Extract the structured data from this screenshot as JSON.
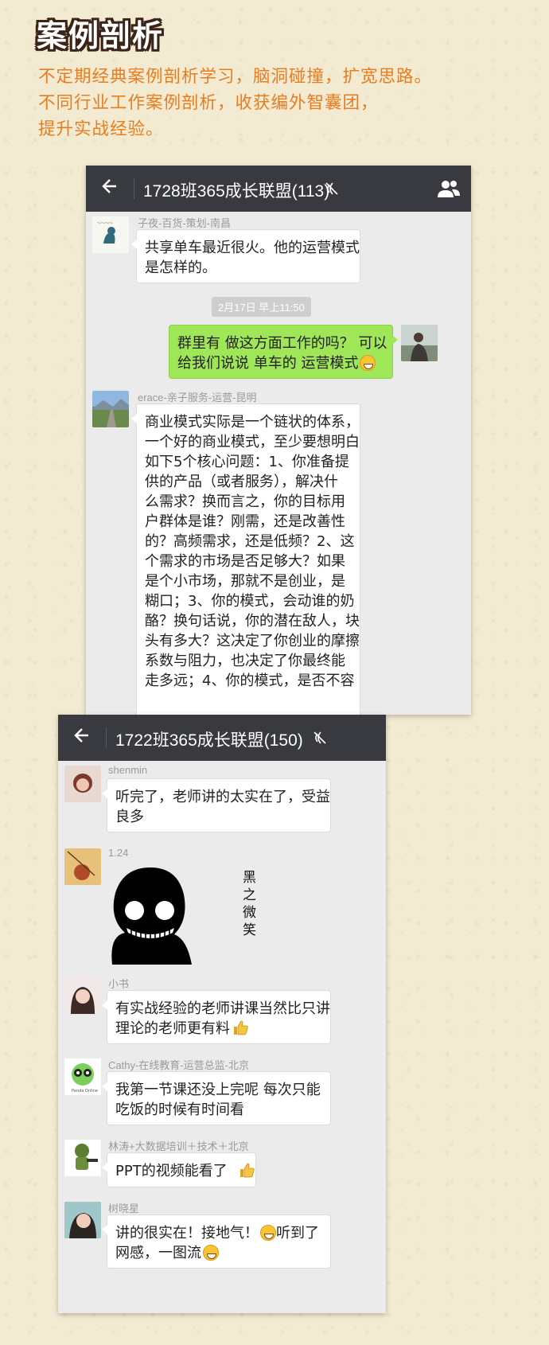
{
  "header": {
    "title": "案例剖析",
    "intro_lines": [
      "不定期经典案例剖析学习，脑洞碰撞，扩宽思路。",
      "不同行业工作案例剖析，收获编外智囊团，",
      "提升实战经验。"
    ]
  },
  "chat1": {
    "title": "1728班365成长联盟(113)",
    "messages": [
      {
        "sender": "子夜-百货-策划-南昌",
        "lines": [
          "共享单车最近很火。他的运营模式",
          "是怎样的。"
        ]
      },
      {
        "timestamp": "2月17日 早上11:50"
      },
      {
        "outgoing": true,
        "lines": [
          "群里有 做这方面工作的吗？ 可以",
          "给我们说说 单车的 运营模式"
        ],
        "emoji": "grin"
      },
      {
        "sender": "erace-亲子服务-运营-昆明",
        "lines": [
          "商业模式实际是一个链状的体系，",
          "一个好的商业模式，至少要想明白",
          "如下5个核心问题：1、你准备提",
          "供的产品（或者服务），解决什",
          "么需求？换而言之，你的目标用",
          "户群体是谁？刚需，还是改善性",
          "的？高频需求，还是低频？2、这",
          "个需求的市场是否足够大？如果",
          "是个小市场，那就不是创业，是",
          "糊口；3、你的模式，会动谁的奶",
          "酪？换句话说，你的潜在敌人，块",
          "头有多大？这决定了你创业的摩擦",
          "系数与阻力，也决定了你最终能",
          "走多远；4、你的模式，是否不容"
        ]
      }
    ]
  },
  "chat2": {
    "title": "1722班365成长联盟(150)",
    "messages": [
      {
        "sender": "shenmin",
        "lines": [
          "听完了，老师讲的太实在了，受益",
          "良多"
        ]
      },
      {
        "sender": "1.24",
        "sticker_text": [
          "黑",
          "之",
          "微",
          "笑"
        ]
      },
      {
        "sender": "小书",
        "lines": [
          "有实战经验的老师讲课当然比只讲",
          "理论的老师更有料"
        ],
        "emoji": "thumbs-up"
      },
      {
        "sender": "Cathy-在线教育-运营总监-北京",
        "lines": [
          "我第一节课还没上完呢 每次只能",
          "吃饭的时候有时间看"
        ]
      },
      {
        "sender": "林涛+大数据培训＋技术＋北京",
        "lines": [
          "PPT的视频能看了"
        ],
        "emoji": "thumbs-up"
      },
      {
        "sender": "树晓星",
        "lines": [
          "讲的很实在！接地气！",
          "网感，一图流"
        ],
        "emoji_mid": "grin",
        "after_mid": "听到了",
        "emoji": "laugh-cry"
      }
    ]
  }
}
